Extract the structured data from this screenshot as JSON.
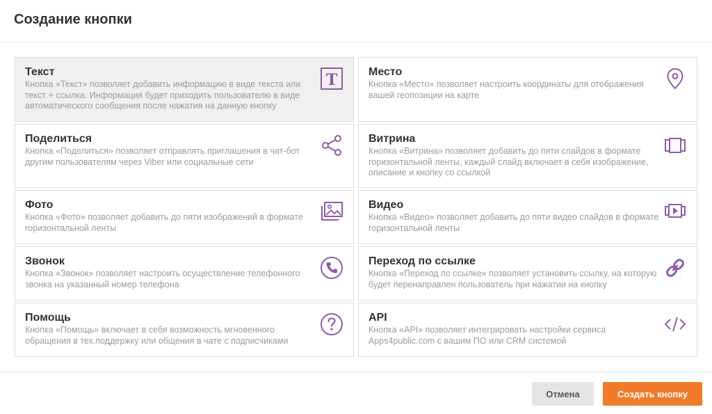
{
  "dialog": {
    "title": "Создание кнопки"
  },
  "cards": [
    {
      "title": "Текст",
      "description": "Кнопка «Текст» позволяет добавить информацию в виде текста или текст + ссылка. Информация будет приходить пользователю в виде автоматического сообщения после нажатия на данную кнопку",
      "icon": "text-icon",
      "selected": true
    },
    {
      "title": "Место",
      "description": "Кнопка «Место» позволяет настроить координаты для отображения вашей геопозиции на карте",
      "icon": "location-pin-icon"
    },
    {
      "title": "Поделиться",
      "description": "Кнопка «Поделиться» позволяет отправлять приглашения в чат-бот другим пользователям через Viber или социальные сети",
      "icon": "share-icon"
    },
    {
      "title": "Витрина",
      "description": "Кнопка «Витрина» позволяет добавить до пяти слайдов в формате горизонтальной ленты, каждый слайд включает в себя изображение, описание и кнопку со ссылкой",
      "icon": "carousel-icon"
    },
    {
      "title": "Фото",
      "description": "Кнопка «Фото» позволяет добавить до пяти изображений в формате горизонтальной ленты",
      "icon": "photo-gallery-icon"
    },
    {
      "title": "Видео",
      "description": "Кнопка «Видео» позволяет добавить до пяти видео слайдов в формате горизонтальной ленты",
      "icon": "video-carousel-icon"
    },
    {
      "title": "Звонок",
      "description": "Кнопка «Звонок» позволяет настроить осуществление телефонного звонка на указанный номер телефона",
      "icon": "phone-icon"
    },
    {
      "title": "Переход по ссылке",
      "description": "Кнопка «Переход по ссылке» позволяет установить ссылку, на которую будет перенаправлен пользователь при нажатии на кнопку",
      "icon": "link-icon"
    },
    {
      "title": "Помощь",
      "description": "Кнопка «Помощь» включает в себя возможность мгновенного обращения в тех.поддержку или общения в чате с подписчиками",
      "icon": "help-icon"
    },
    {
      "title": "API",
      "description": "Кнопка «API» позволяет интегрировать настройки сервиса Apps4public.com с вашим ПО или CRM системой",
      "icon": "code-icon"
    }
  ],
  "footer": {
    "cancel_label": "Отмена",
    "create_label": "Создать кнопку"
  },
  "colors": {
    "accent": "#f07c2b",
    "icon": "#8e5ba8"
  }
}
